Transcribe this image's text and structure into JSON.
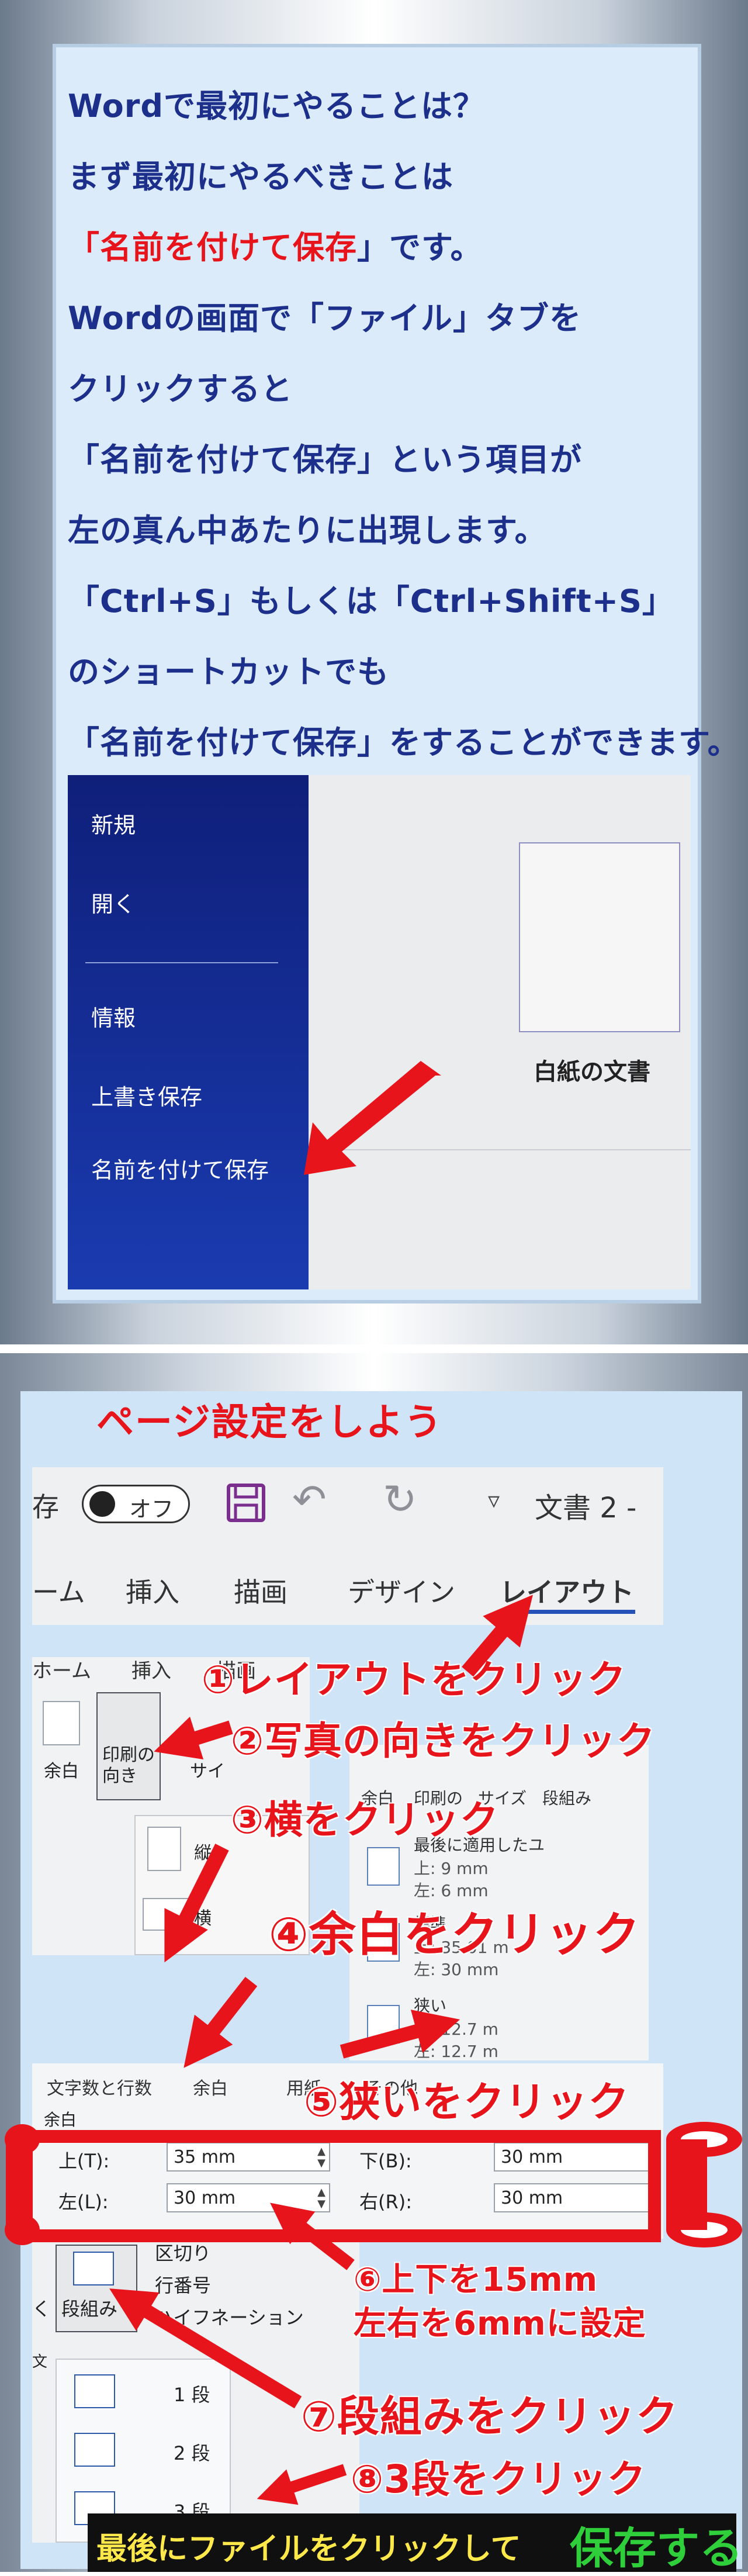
{
  "intro": {
    "lines": [
      "Wordで最初にやることは？",
      "まず最初にやるべきことは",
      "」です。",
      "Wordの画面で「ファイル」タブを",
      "クリックすると",
      "「名前を付けて保存」という項目が",
      "左の真ん中あたりに出現します。",
      "「Ctrl+S」もしくは「Ctrl+Shift+S」",
      "のショートカットでも",
      "「名前を付けて保存」をすることができます。"
    ],
    "highlight": "「名前を付けて保存",
    "highlight_color": "#e8141b",
    "text_color": "#1c2f8a"
  },
  "backstage": {
    "items": [
      "新規",
      "開く",
      "情報",
      "上書き保存",
      "名前を付けて保存"
    ],
    "blank_document": "白紙の文書",
    "sidebar_color": "#1a3bb0"
  },
  "section2": {
    "title": "ページ設定をしよう",
    "ribbon": {
      "autosave_prefix": "存",
      "autosave_state": "オフ",
      "qat_more": "▿",
      "doc_title": "文書 2  -",
      "tabs": [
        "ーム",
        "挿入",
        "描画",
        "デザイン",
        "レイアウト"
      ],
      "active_tab": "レイアウト"
    },
    "layout_ribbon": {
      "tabs": [
        "ホーム",
        "挿入",
        "描画"
      ],
      "margin_btn": "余白",
      "orientation_btn": "印刷の\n向き",
      "size_btn": "サイ",
      "orientation_options": [
        "縦",
        "横"
      ]
    },
    "margins_menu": {
      "ribbon_labels": [
        "余白",
        "印刷の",
        "サイズ",
        "段組み"
      ],
      "options": [
        {
          "name": "最後に適用したユ",
          "rows": [
            "上:    9 mm",
            "左:    6 mm"
          ]
        },
        {
          "name": "標準",
          "rows": [
            "上:    35.01 m",
            "左:    30 mm"
          ]
        },
        {
          "name": "狭い",
          "rows": [
            "上:    12.7 m",
            "左:    12.7 m"
          ]
        }
      ]
    },
    "page_setup": {
      "tabs": [
        "文字数と行数",
        "余白",
        "用紙",
        "その他"
      ],
      "group_label": "余白",
      "fields": [
        {
          "label": "上(T):",
          "value": "35 mm"
        },
        {
          "label": "下(B):",
          "value": "30 mm"
        },
        {
          "label": "左(L):",
          "value": "30 mm"
        },
        {
          "label": "右(R):",
          "value": "30 mm"
        }
      ]
    },
    "columns": {
      "button": "段組み",
      "menu_items": [
        "区切り",
        "行番号",
        "ハイフネーション"
      ],
      "options": [
        "1 段",
        "2 段",
        "3 段"
      ],
      "side_label": "く",
      "side_label2": "文"
    },
    "steps": [
      "①レイアウトをクリック",
      "②写真の向きをクリック",
      "③横をクリック",
      "④余白をクリック",
      "⑤狭いをクリック",
      "⑥上下を15mm",
      "左右を6mmに設定",
      "⑦段組みをクリック",
      "⑧3段をクリック"
    ],
    "footer": {
      "text": "最後にファイルをクリックして",
      "save": "保存する"
    },
    "accent_color": "#e8141b"
  }
}
